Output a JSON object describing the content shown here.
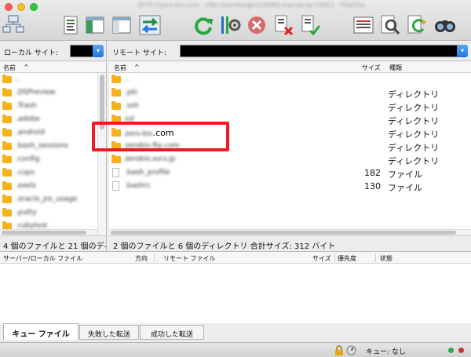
{
  "window": {
    "title": "SFTP://zero-bis.com - sftp://zerobis@sv10060.xserver.jp:10022 - FileZilla"
  },
  "toolbar": {
    "icons": [
      "site-manager-icon",
      "message-log-icon",
      "local-tree-icon",
      "remote-tree-icon",
      "transfer-queue-icon",
      "refresh-icon",
      "filter-icon",
      "cancel-icon",
      "disconnect-icon",
      "reconnect-icon",
      "compare-icon",
      "find-icon",
      "sync-icon",
      "search-remote-icon"
    ]
  },
  "local_site": {
    "label": "ローカル サイト:",
    "value": ""
  },
  "remote_site": {
    "label": "リモート サイト:",
    "value": ""
  },
  "local_pane": {
    "col_name": "名前",
    "sort_arrow": "^",
    "items": [
      {
        "name": ".."
      },
      {
        "name": ".DSPreview"
      },
      {
        "name": ".Trash"
      },
      {
        "name": ".adobe"
      },
      {
        "name": ".android"
      },
      {
        "name": ".bash_sessions"
      },
      {
        "name": ".config"
      },
      {
        "name": ".cups"
      },
      {
        "name": ".exels"
      },
      {
        "name": ".oracle_jre_usage"
      },
      {
        "name": ".putty"
      },
      {
        "name": ".rubytest"
      }
    ],
    "status": "4 個のファイルと 21 個のディ"
  },
  "remote_pane": {
    "col_name": "名前",
    "sort_arrow": "^",
    "col_size": "サイズ",
    "col_type": "種類",
    "items": [
      {
        "name": "..",
        "size": "",
        "type": "",
        "kind": "folder",
        "blurred": true
      },
      {
        "name": ".pki",
        "size": "",
        "type": "ディレクトリ",
        "kind": "folder",
        "blurred": true
      },
      {
        "name": ".ssh",
        "size": "",
        "type": "ディレクトリ",
        "kind": "folder",
        "blurred": true
      },
      {
        "name": "ssl",
        "size": "",
        "type": "ディレクトリ",
        "kind": "folder",
        "blurred": true
      },
      {
        "name_prefix": "zero-bis",
        "name_suffix": ".com",
        "size": "",
        "type": "ディレクトリ",
        "kind": "folder",
        "blurred": false
      },
      {
        "name": "zerobis-ftp.com",
        "size": "",
        "type": "ディレクトリ",
        "kind": "folder",
        "blurred": true
      },
      {
        "name": "zerobis.xsrv.jp",
        "size": "",
        "type": "ディレクトリ",
        "kind": "folder",
        "blurred": true
      },
      {
        "name": ".bash_profile",
        "size": "182",
        "type": "ファイル",
        "kind": "file",
        "blurred": true
      },
      {
        "name": ".bashrc",
        "size": "130",
        "type": "ファイル",
        "kind": "file",
        "blurred": true
      }
    ],
    "status": "2 個のファイルと 6 個のディレクトリ 合計サイズ: 312 バイト"
  },
  "queue": {
    "columns": [
      "サーバー/ローカル ファイル",
      "方向",
      "リモート ファイル",
      "サイズ",
      "優先度",
      "状態"
    ]
  },
  "tabs": [
    {
      "label": "キュー ファイル",
      "active": true
    },
    {
      "label": "失敗した転送",
      "active": false
    },
    {
      "label": "成功した転送",
      "active": false
    }
  ],
  "bottombar": {
    "queue_label": "キュー: なし"
  },
  "colors": {
    "highlight": "#ec1c24",
    "folder": "#f7b21b",
    "accent": "#1c77e8"
  }
}
